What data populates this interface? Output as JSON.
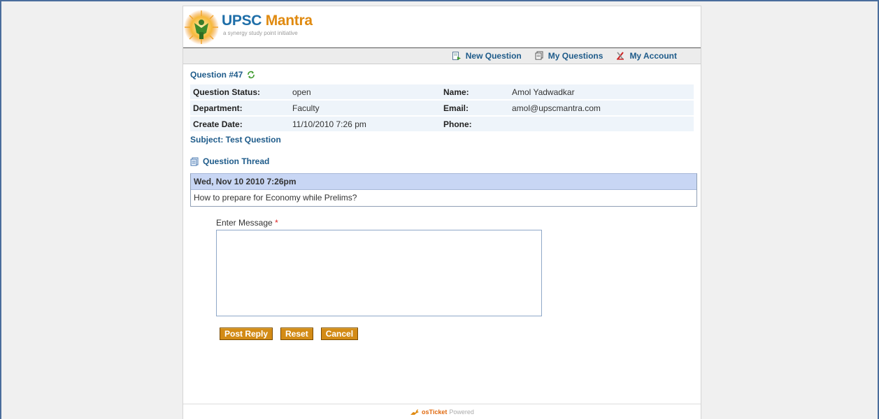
{
  "brand": {
    "title_main": "UPSC ",
    "title_accent": "Mantra",
    "subtitle": "a synergy study point initiative"
  },
  "nav": {
    "new_question": "New Question",
    "my_questions": "My Questions",
    "my_account": "My Account"
  },
  "question": {
    "title": "Question #47",
    "info": {
      "status_label": "Question Status:",
      "status_value": "open",
      "name_label": "Name:",
      "name_value": "Amol Yadwadkar",
      "department_label": "Department:",
      "department_value": "Faculty",
      "email_label": "Email:",
      "email_value": "amol@upscmantra.com",
      "create_date_label": "Create Date:",
      "create_date_value": "11/10/2010 7:26 pm",
      "phone_label": "Phone:",
      "phone_value": ""
    },
    "subject": "Subject: Test Question"
  },
  "thread": {
    "heading": "Question Thread",
    "messages": [
      {
        "date": "Wed, Nov 10 2010 7:26pm",
        "body": "How to prepare for Economy while Prelims?"
      }
    ]
  },
  "reply": {
    "label": "Enter Message",
    "required_mark": "*",
    "message_value": "",
    "post_label": "Post Reply",
    "reset_label": "Reset",
    "cancel_label": "Cancel"
  },
  "footer": {
    "brand": "osTicket",
    "suffix": "Powered"
  },
  "colors": {
    "brand_blue": "#1e6ea8",
    "brand_orange": "#e08a10",
    "button": "#d38b16",
    "thread_header": "#c8d6f4",
    "info_row": "#eef4fa"
  },
  "icons": [
    "sun-logo-icon",
    "new-question-icon",
    "my-questions-icon",
    "my-account-icon",
    "refresh-icon",
    "thread-icon",
    "kangaroo-icon"
  ]
}
